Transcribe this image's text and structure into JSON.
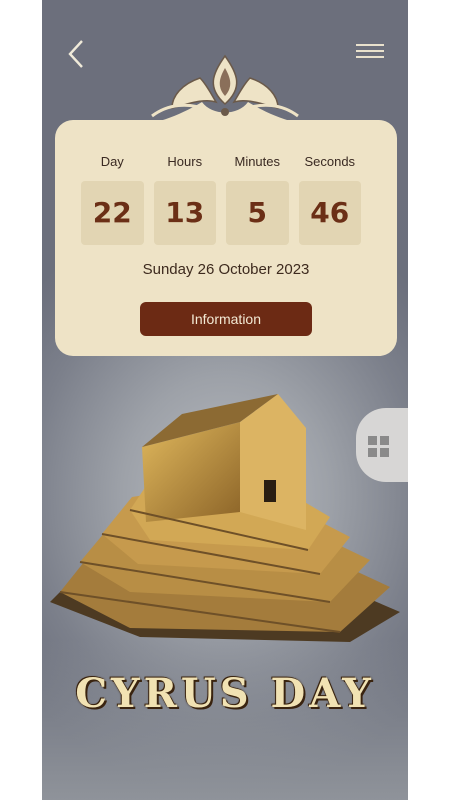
{
  "header": {
    "back_icon": "chevron-left-icon",
    "menu_icon": "hamburger-menu-icon"
  },
  "countdown": {
    "labels": [
      "Day",
      "Hours",
      "Minutes",
      "Seconds"
    ],
    "values": [
      "22",
      "13",
      "5",
      "46"
    ],
    "date": "Sunday 26 October 2023",
    "button_label": "Information"
  },
  "side_tab": {
    "icon": "grid-icon"
  },
  "hero": {
    "title": "CYRUS DAY",
    "image": "tomb-of-cyrus"
  },
  "colors": {
    "card": "#eee3c6",
    "accent": "#6c2a14",
    "title": "#f1e2b3"
  }
}
